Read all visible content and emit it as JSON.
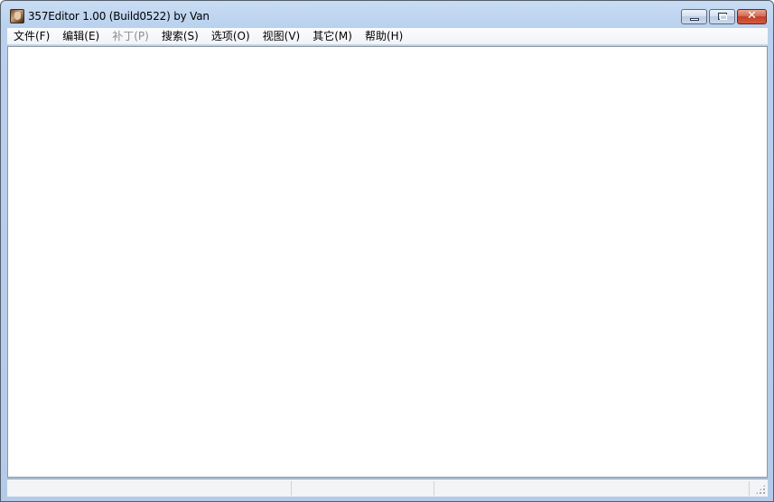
{
  "window": {
    "title": "357Editor 1.00 (Build0522) by Van",
    "icon": "app-portrait-icon"
  },
  "caption": {
    "minimize_icon": "minimize-icon",
    "restore_icon": "restore-icon",
    "close_glyph": "✕"
  },
  "menu": {
    "items": [
      {
        "label": "文件(F)",
        "enabled": true
      },
      {
        "label": "编辑(E)",
        "enabled": true
      },
      {
        "label": "补丁(P)",
        "enabled": false
      },
      {
        "label": "搜索(S)",
        "enabled": true
      },
      {
        "label": "选项(O)",
        "enabled": true
      },
      {
        "label": "视图(V)",
        "enabled": true
      },
      {
        "label": "其它(M)",
        "enabled": true
      },
      {
        "label": "帮助(H)",
        "enabled": true
      }
    ]
  },
  "statusbar": {
    "segments": [
      "",
      "",
      ""
    ]
  },
  "colors": {
    "title_gradient_top": "#c9dcf3",
    "close_button": "#c0412a",
    "disabled_text": "#8d8d8d"
  }
}
